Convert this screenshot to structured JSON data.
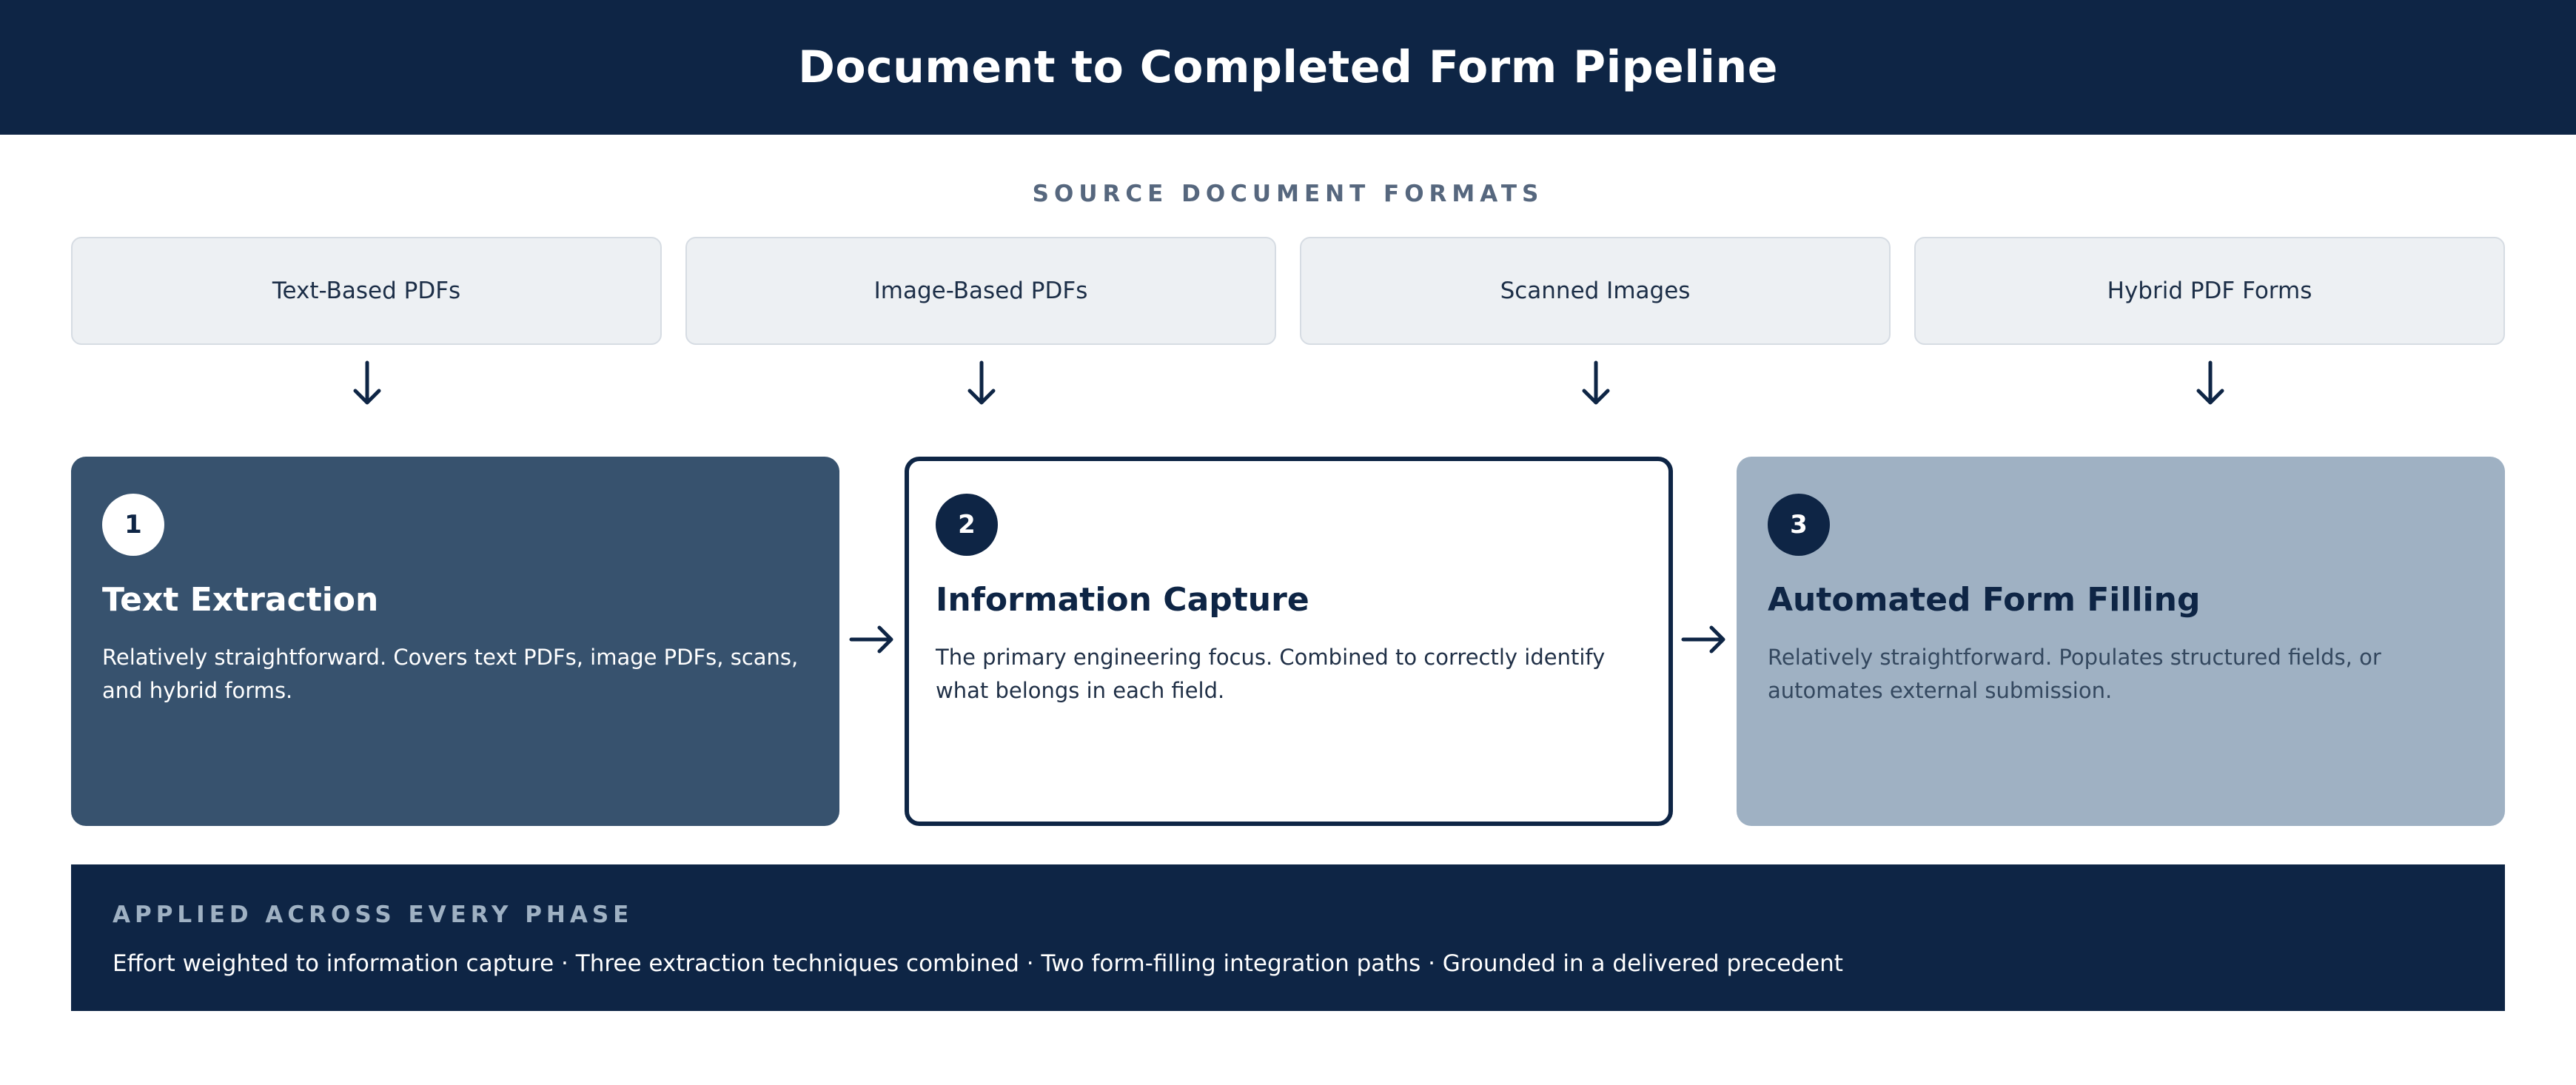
{
  "header": {
    "title": "Document to Completed Form Pipeline"
  },
  "formats": {
    "label": "SOURCE DOCUMENT FORMATS",
    "items": [
      "Text-Based PDFs",
      "Image-Based PDFs",
      "Scanned Images",
      "Hybrid PDF Forms"
    ]
  },
  "phases": [
    {
      "number": "1",
      "title": "Text Extraction",
      "description": "Relatively straightforward. Covers text PDFs, image PDFs, scans, and hybrid forms."
    },
    {
      "number": "2",
      "title": "Information Capture",
      "description": "The primary engineering focus. Combined to correctly identify what belongs in each field."
    },
    {
      "number": "3",
      "title": "Automated Form Filling",
      "description": "Relatively straightforward. Populates structured fields, or automates external submission."
    }
  ],
  "footer": {
    "label": "APPLIED ACROSS EVERY PHASE",
    "text": "Effort weighted to information capture · Three extraction techniques combined · Two form-filling integration paths · Grounded in a delivered precedent"
  },
  "colors": {
    "navy": "#0e2545",
    "slate": "#37526e",
    "light_blue_gray": "#9fb1c3",
    "format_bg": "#edf0f3"
  }
}
